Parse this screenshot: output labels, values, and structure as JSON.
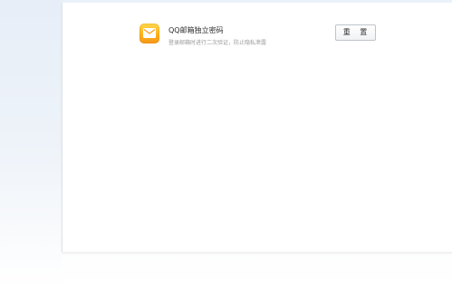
{
  "setting": {
    "icon": "mail-envelope-icon",
    "title": "QQ邮箱独立密码",
    "description": "登录邮箱时进行二次验证，防止隐私泄露",
    "reset_label": "重 置"
  },
  "colors": {
    "icon_gradient_top": "#ffd84a",
    "icon_gradient_bottom": "#f5961a",
    "background_tint": "#eaf1f9"
  }
}
